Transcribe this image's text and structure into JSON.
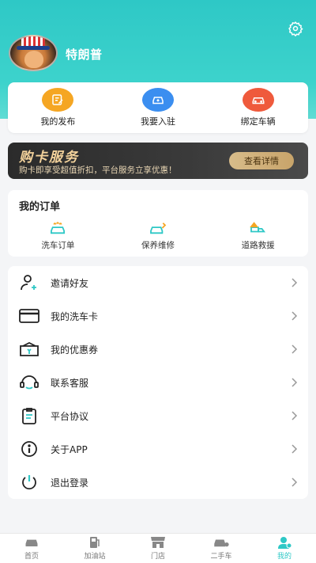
{
  "profile": {
    "username": "特朗普"
  },
  "quick_actions": [
    {
      "label": "我的发布",
      "icon": "edit-document-icon",
      "color": "#f5a623"
    },
    {
      "label": "我要入驻",
      "icon": "car-add-icon",
      "color": "#3b8ef0"
    },
    {
      "label": "绑定车辆",
      "icon": "car-icon",
      "color": "#ef5a3c"
    }
  ],
  "banner": {
    "title": "购卡服务",
    "subtitle": "购卡即享受超值折扣，平台服务立享优惠！",
    "button_label": "查看详情"
  },
  "orders": {
    "title": "我的订单",
    "items": [
      {
        "label": "洗车订单",
        "icon": "car-wash-icon"
      },
      {
        "label": "保养维修",
        "icon": "car-repair-icon"
      },
      {
        "label": "道路救援",
        "icon": "tow-truck-icon"
      }
    ]
  },
  "menu": [
    {
      "label": "邀请好友",
      "icon": "add-user-icon"
    },
    {
      "label": "我的洗车卡",
      "icon": "card-icon"
    },
    {
      "label": "我的优惠券",
      "icon": "coupon-icon"
    },
    {
      "label": "联系客服",
      "icon": "headset-icon"
    },
    {
      "label": "平台协议",
      "icon": "clipboard-icon"
    },
    {
      "label": "关于APP",
      "icon": "info-icon"
    },
    {
      "label": "退出登录",
      "icon": "power-icon"
    }
  ],
  "tabbar": [
    {
      "label": "首页",
      "icon": "car-home-icon",
      "active": false
    },
    {
      "label": "加油站",
      "icon": "gas-pump-icon",
      "active": false
    },
    {
      "label": "门店",
      "icon": "store-icon",
      "active": false
    },
    {
      "label": "二手车",
      "icon": "used-car-icon",
      "active": false
    },
    {
      "label": "我的",
      "icon": "user-icon",
      "active": true
    }
  ],
  "colors": {
    "brand": "#2ec8c6",
    "banner_gold": "#f4d39c"
  }
}
